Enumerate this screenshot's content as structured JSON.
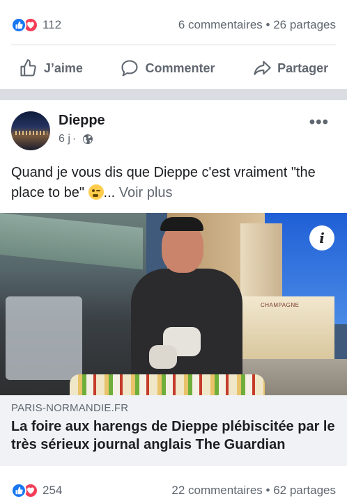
{
  "prev_post": {
    "reactions_count": "112",
    "comments": "6 commentaires",
    "shares": "26 partages",
    "separator": "•",
    "actions": {
      "like": "J’aime",
      "comment": "Commenter",
      "share": "Partager"
    }
  },
  "post": {
    "page_name": "Dieppe",
    "time": "6 j",
    "dot": "·",
    "text": "Quand je vous dis que Dieppe c'est vraiment \"the place to be\" ",
    "ellipsis": "... ",
    "see_more": "Voir plus",
    "more_menu": "•••",
    "link": {
      "info": "i",
      "domain": "PARIS-NORMANDIE.FR",
      "title": "La foire aux harengs de Dieppe plébiscitée par le très sérieux journal anglais The Guardian",
      "sign_text": "CHAMPAGNE"
    },
    "reactions_count": "254",
    "comments": "22 commentaires",
    "shares": "62 partages",
    "separator": "•"
  },
  "colors": {
    "like": "#1877f2",
    "love": "#f33e58",
    "muted": "#606770"
  }
}
